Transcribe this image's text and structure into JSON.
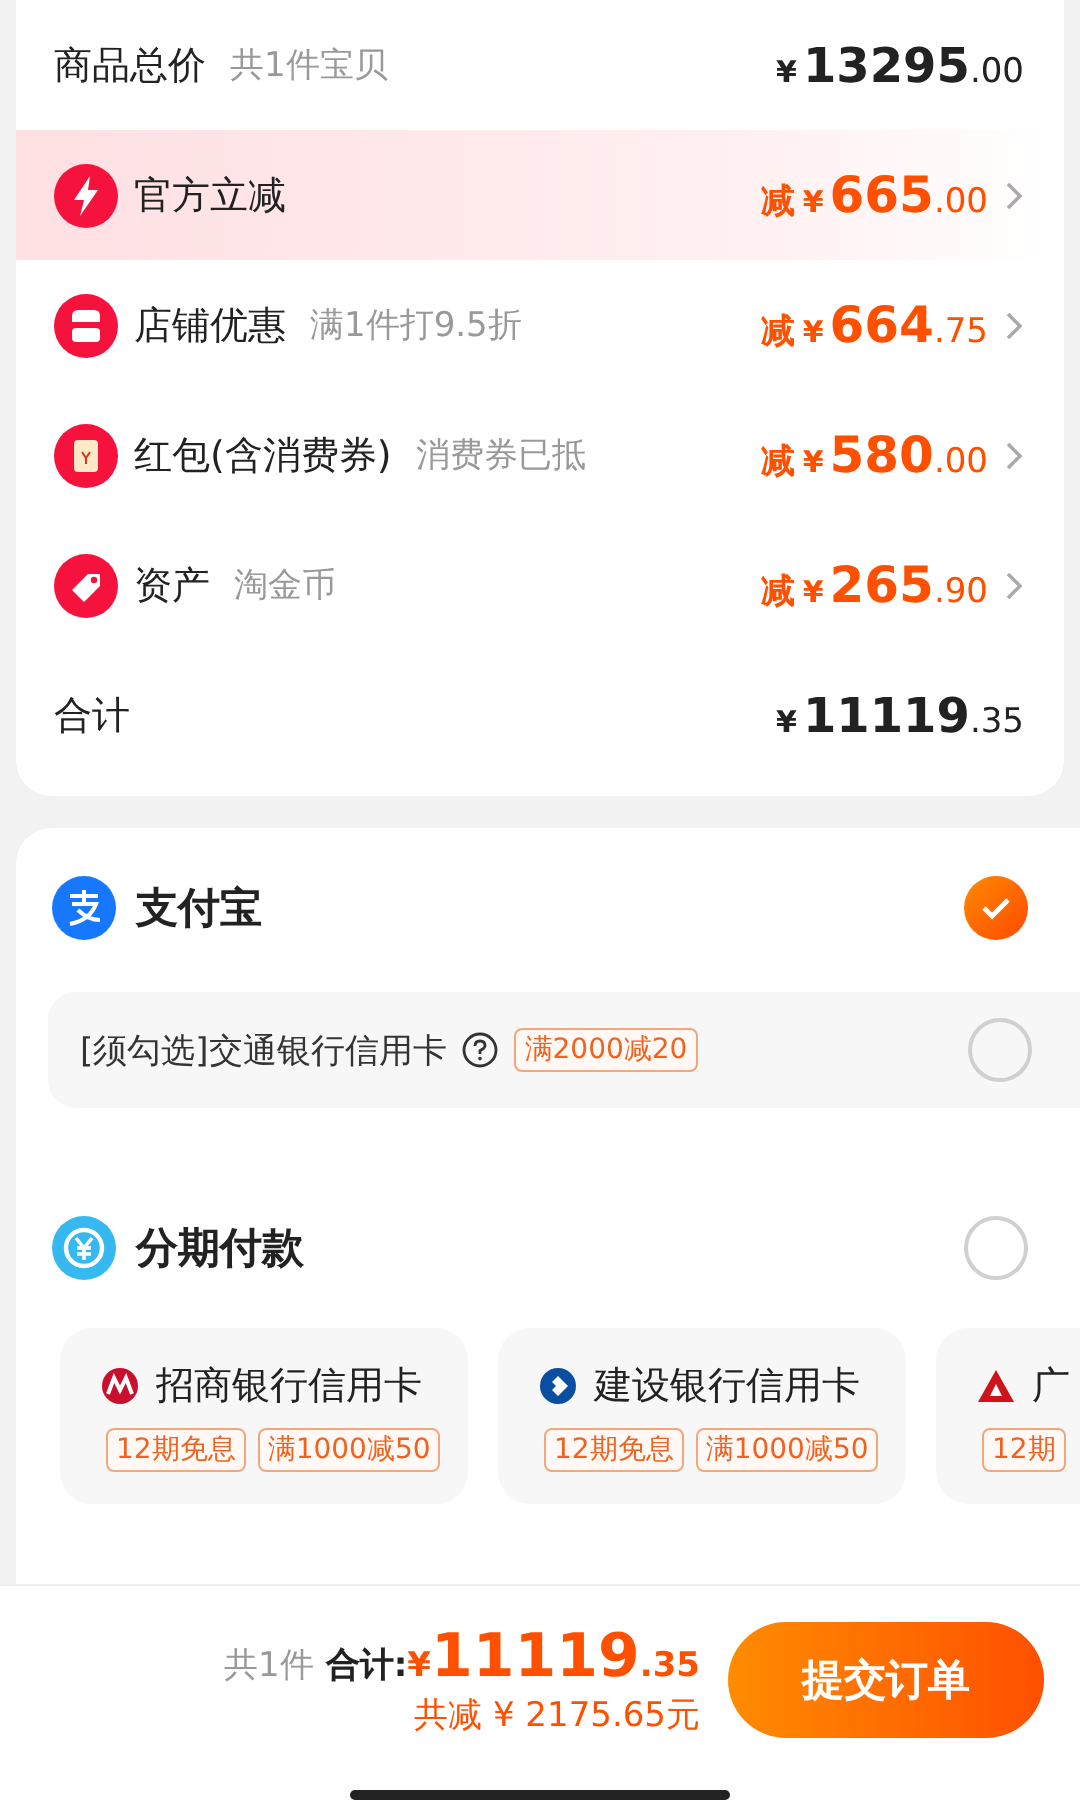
{
  "summary": {
    "label": "商品总价",
    "note": "共1件宝贝",
    "price": {
      "currency": "¥",
      "integer": "13295",
      "decimal": ".00"
    }
  },
  "discounts": [
    {
      "label": "官方立减",
      "highlighted": true,
      "prefix": "减",
      "price": {
        "currency": "¥",
        "integer": "665",
        "decimal": ".00"
      }
    },
    {
      "label": "店铺优惠",
      "note": "满1件打9.5折",
      "highlighted": false,
      "prefix": "减",
      "price": {
        "currency": "¥",
        "integer": "664",
        "decimal": ".75"
      }
    },
    {
      "label": "红包(含消费券)",
      "note": "消费券已抵",
      "highlighted": false,
      "prefix": "减",
      "price": {
        "currency": "¥",
        "integer": "580",
        "decimal": ".00"
      }
    },
    {
      "label": "资产",
      "note": "淘金币",
      "highlighted": false,
      "prefix": "减",
      "price": {
        "currency": "¥",
        "integer": "265",
        "decimal": ".90"
      }
    }
  ],
  "total": {
    "label": "合计",
    "price": {
      "currency": "¥",
      "integer": "11119",
      "decimal": ".35"
    }
  },
  "payment": {
    "method": {
      "label": "支付宝",
      "checked": true
    },
    "option": {
      "label": "[须勾选]交通银行信用卡",
      "tag": "满2000减20",
      "checked": false
    },
    "installment": {
      "label": "分期付款",
      "checked": false
    },
    "banks": [
      {
        "name": "招商银行信用卡",
        "tags": [
          "12期免息",
          "满1000减50"
        ]
      },
      {
        "name": "建设银行信用卡",
        "tags": [
          "12期免息",
          "满1000减50"
        ]
      },
      {
        "name": "广",
        "tags": [
          "12期"
        ]
      }
    ]
  },
  "footer": {
    "count": "共1件",
    "total_label": "合计:",
    "currency": "¥",
    "integer": "11119",
    "decimal": ".35",
    "saved": "共减 ¥ 2175.65元",
    "submit": "提交订单"
  }
}
